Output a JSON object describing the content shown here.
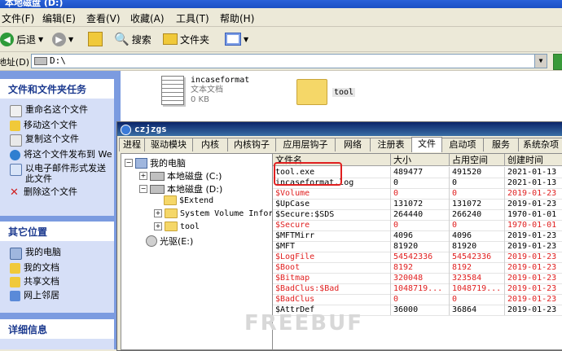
{
  "window": {
    "title": "本地磁盘 (D:)"
  },
  "menu": [
    "文件(F)",
    "编辑(E)",
    "查看(V)",
    "收藏(A)",
    "工具(T)",
    "帮助(H)"
  ],
  "toolbar": {
    "back": "后退",
    "search": "搜索",
    "folders": "文件夹"
  },
  "address": {
    "label": "地址(D)",
    "value": "D:\\"
  },
  "tasks": {
    "heading": "文件和文件夹任务",
    "items": [
      "重命名这个文件",
      "移动这个文件",
      "复制这个文件",
      "将这个文件发布到 We",
      "以电子邮件形式发送此文件",
      "删除这个文件"
    ]
  },
  "places": {
    "heading": "其它位置",
    "items": [
      "我的电脑",
      "我的文档",
      "共享文档",
      "网上邻居"
    ]
  },
  "details": {
    "heading": "详细信息"
  },
  "files": [
    {
      "name": "incaseformat",
      "type": "文本文档",
      "size": "0 KB"
    },
    {
      "name": "tool"
    }
  ],
  "tool_window": {
    "title": "czjzgs",
    "tabs": [
      "进程",
      "驱动模块",
      "内核",
      "内核钩子",
      "应用层钩子",
      "网络",
      "注册表",
      "文件",
      "启动项",
      "服务",
      "系统杂项"
    ],
    "active_tab": "文件",
    "tree": {
      "root": "我的电脑",
      "c": "本地磁盘 (C:)",
      "d": "本地磁盘 (D:)",
      "extend": "$Extend",
      "svi": "System Volume Inform",
      "tool": "tool",
      "e": "光驱(E:)"
    },
    "columns": [
      "文件名",
      "大小",
      "占用空间",
      "创建时间"
    ],
    "rows": [
      {
        "name": "tool.exe",
        "size": "489477",
        "used": "491520",
        "created": "2021-01-13",
        "red": false
      },
      {
        "name": "incaseformat.log",
        "size": "0",
        "used": "0",
        "created": "2021-01-13",
        "red": false
      },
      {
        "name": "$Volume",
        "size": "0",
        "used": "0",
        "created": "2019-01-23",
        "red": true
      },
      {
        "name": "$UpCase",
        "size": "131072",
        "used": "131072",
        "created": "2019-01-23",
        "red": false
      },
      {
        "name": "$Secure:$SDS",
        "size": "264440",
        "used": "266240",
        "created": "1970-01-01",
        "red": false
      },
      {
        "name": "$Secure",
        "size": "0",
        "used": "0",
        "created": "1970-01-01",
        "red": true
      },
      {
        "name": "$MFTMirr",
        "size": "4096",
        "used": "4096",
        "created": "2019-01-23",
        "red": false
      },
      {
        "name": "$MFT",
        "size": "81920",
        "used": "81920",
        "created": "2019-01-23",
        "red": false
      },
      {
        "name": "$LogFile",
        "size": "54542336",
        "used": "54542336",
        "created": "2019-01-23",
        "red": true
      },
      {
        "name": "$Boot",
        "size": "8192",
        "used": "8192",
        "created": "2019-01-23",
        "red": true
      },
      {
        "name": "$Bitmap",
        "size": "320048",
        "used": "323584",
        "created": "2019-01-23",
        "red": true
      },
      {
        "name": "$BadClus:$Bad",
        "size": "1048719...",
        "used": "1048719...",
        "created": "2019-01-23",
        "red": true
      },
      {
        "name": "$BadClus",
        "size": "0",
        "used": "0",
        "created": "2019-01-23",
        "red": true
      },
      {
        "name": "$AttrDef",
        "size": "36000",
        "used": "36864",
        "created": "2019-01-23",
        "red": false
      }
    ]
  },
  "watermark": "FREEBUF",
  "colors": {
    "accent": "#e02020",
    "sidebar": "#7b9be0"
  }
}
